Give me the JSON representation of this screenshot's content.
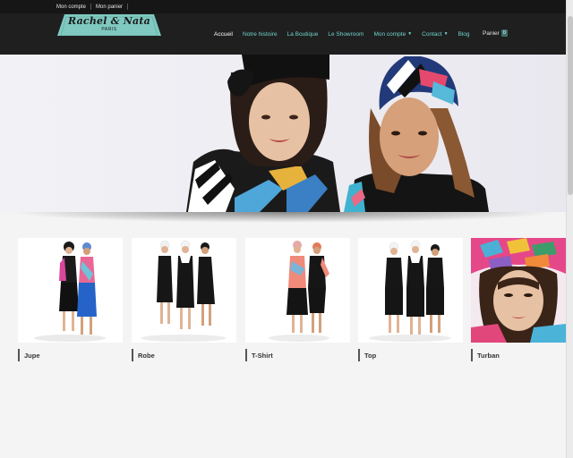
{
  "topbar": {
    "links": [
      {
        "label": "Mon compte"
      },
      {
        "label": "Mon panier"
      }
    ]
  },
  "header": {
    "logo": {
      "name": "Rachel & Nata",
      "city": "PARIS"
    },
    "nav": [
      {
        "label": "Accueil",
        "active": true
      },
      {
        "label": "Notre histoire"
      },
      {
        "label": "La Boutique"
      },
      {
        "label": "Le Showroom"
      },
      {
        "label": "Mon compte",
        "dropdown": true
      },
      {
        "label": "Contact",
        "dropdown": true
      },
      {
        "label": "Blog"
      }
    ],
    "cart": {
      "label": "Panier",
      "count": "0"
    }
  },
  "colors": {
    "accent": "#6fd3cc",
    "header_bg": "#1f1f1f",
    "logo_bg": "#7fc9c0"
  },
  "icons": {
    "dropdown": "chevron-down-icon"
  },
  "products": [
    {
      "label": "Jupe"
    },
    {
      "label": "Robe"
    },
    {
      "label": "T-Shirt"
    },
    {
      "label": "Top"
    },
    {
      "label": "Turban"
    }
  ]
}
